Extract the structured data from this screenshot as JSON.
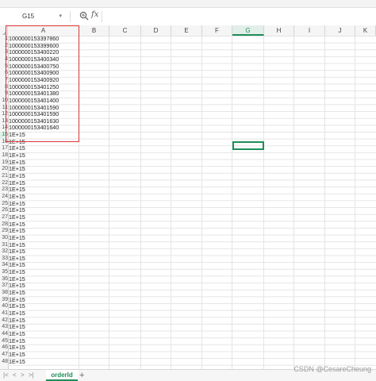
{
  "toolbar_strip": "",
  "formula_bar": {
    "name_box": "G15",
    "fx_label": "fx",
    "formula_value": ""
  },
  "columns": [
    "A",
    "B",
    "C",
    "D",
    "E",
    "F",
    "G",
    "H",
    "I",
    "J",
    "K"
  ],
  "active_column": "G",
  "rows": [
    {
      "n": "1",
      "a": "1000000153397860"
    },
    {
      "n": "2",
      "a": "1000000153399600"
    },
    {
      "n": "3",
      "a": "1000000153400220"
    },
    {
      "n": "4",
      "a": "1000000153400340"
    },
    {
      "n": "5",
      "a": "1000000153400750"
    },
    {
      "n": "6",
      "a": "1000000153400900"
    },
    {
      "n": "7",
      "a": "1000000153400920"
    },
    {
      "n": "8",
      "a": "1000000153401250"
    },
    {
      "n": "9",
      "a": "1000000153401380"
    },
    {
      "n": "10",
      "a": "1000000153401400"
    },
    {
      "n": "11",
      "a": "1000000153401590"
    },
    {
      "n": "12",
      "a": "1000000153401590"
    },
    {
      "n": "13",
      "a": "1000000153401630"
    },
    {
      "n": "14",
      "a": "1000000153401640"
    },
    {
      "n": "15",
      "a": "1E+15"
    },
    {
      "n": "16",
      "a": "1E+15"
    },
    {
      "n": "17",
      "a": "1E+15"
    },
    {
      "n": "18",
      "a": "1E+15"
    },
    {
      "n": "19",
      "a": "1E+15"
    },
    {
      "n": "20",
      "a": "1E+15"
    },
    {
      "n": "21",
      "a": "1E+15"
    },
    {
      "n": "22",
      "a": "1E+15"
    },
    {
      "n": "23",
      "a": "1E+15"
    },
    {
      "n": "24",
      "a": "1E+15"
    },
    {
      "n": "25",
      "a": "1E+15"
    },
    {
      "n": "26",
      "a": "1E+15"
    },
    {
      "n": "27",
      "a": "1E+15"
    },
    {
      "n": "28",
      "a": "1E+15"
    },
    {
      "n": "29",
      "a": "1E+15"
    },
    {
      "n": "30",
      "a": "1E+15"
    },
    {
      "n": "31",
      "a": "1E+15"
    },
    {
      "n": "32",
      "a": "1E+15"
    },
    {
      "n": "33",
      "a": "1E+15"
    },
    {
      "n": "34",
      "a": "1E+15"
    },
    {
      "n": "35",
      "a": "1E+15"
    },
    {
      "n": "36",
      "a": "1E+15"
    },
    {
      "n": "37",
      "a": "1E+15"
    },
    {
      "n": "38",
      "a": "1E+15"
    },
    {
      "n": "39",
      "a": "1E+15"
    },
    {
      "n": "40",
      "a": "1E+15"
    },
    {
      "n": "41",
      "a": "1E+15"
    },
    {
      "n": "42",
      "a": "1E+15"
    },
    {
      "n": "43",
      "a": "1E+15"
    },
    {
      "n": "44",
      "a": "1E+15"
    },
    {
      "n": "45",
      "a": "1E+15"
    },
    {
      "n": "46",
      "a": "1E+15"
    },
    {
      "n": "47",
      "a": "1E+15"
    },
    {
      "n": "48",
      "a": "1E+15"
    }
  ],
  "active_row": "15",
  "sheet_bar": {
    "nav_first": "|<",
    "nav_prev": "<",
    "nav_next": ">",
    "nav_last": ">|",
    "sheet_name": "orderId",
    "add_label": "+"
  },
  "watermark": "CSDN @CesareCheung",
  "colors": {
    "accent": "#1e8e5a",
    "highlight_box": "#d9363a",
    "gridline": "#e4e4e4"
  },
  "icons": {
    "zoom": "magnifier-plus-icon",
    "name_box_dropdown": "chevron-down-icon"
  }
}
